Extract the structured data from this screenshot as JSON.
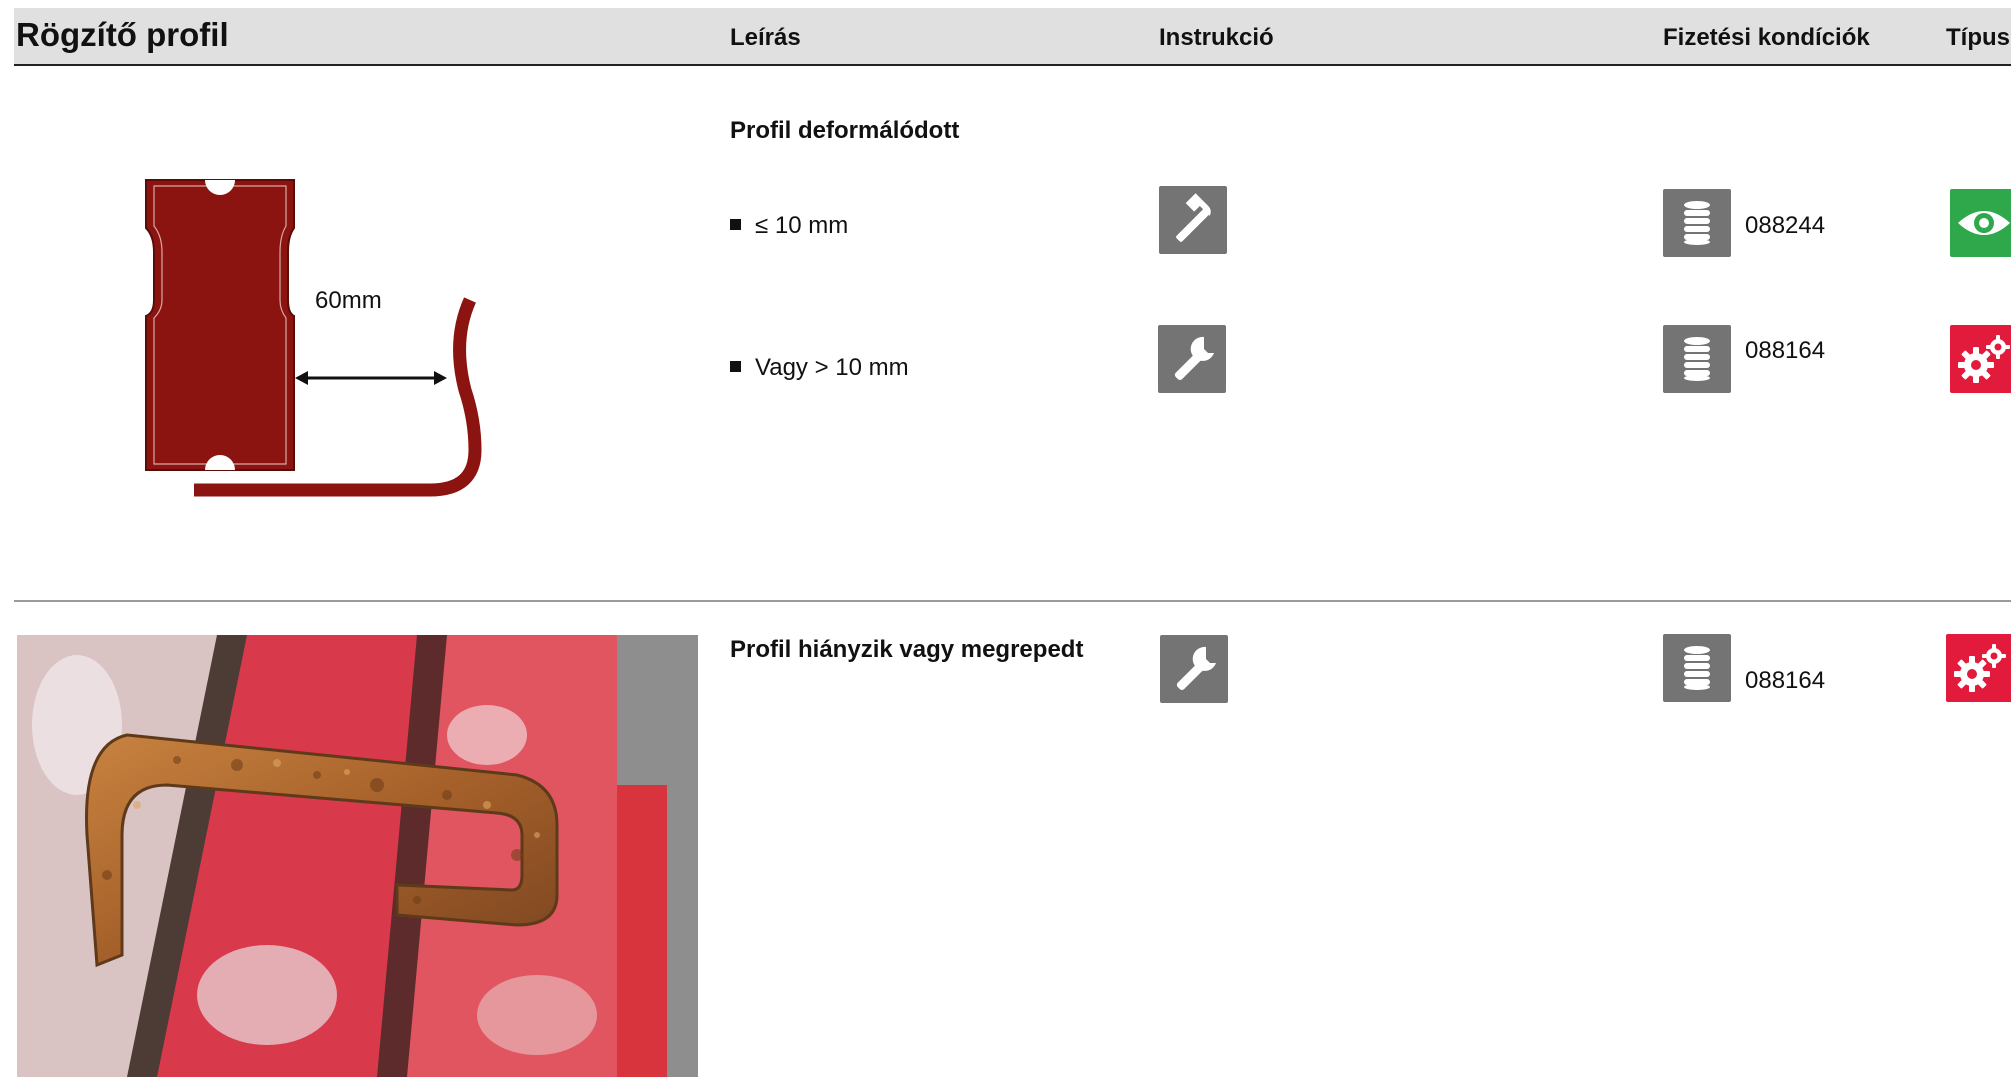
{
  "header": {
    "title": "Rögzítő profil",
    "columns": [
      "Leírás",
      "Instrukció",
      "Fizetési kondíciók",
      "Típus"
    ]
  },
  "rows": [
    {
      "heading": "Profil deformálódott",
      "diagram_label": "60mm",
      "items": [
        {
          "text": "≤ 10 mm",
          "instruction_icon": "hammer-icon",
          "payment_icon": "coin-stack-icon",
          "code": "088244",
          "type_icon": "eye-icon",
          "type_color": "#2ea84a"
        },
        {
          "text": "Vagy > 10 mm",
          "instruction_icon": "wrench-icon",
          "payment_icon": "coin-stack-icon",
          "code": "088164",
          "type_icon": "gears-icon",
          "type_color": "#e21b3c"
        }
      ]
    },
    {
      "heading": "Profil hiányzik vagy megrepedt",
      "instruction_icon": "wrench-icon",
      "payment_icon": "coin-stack-icon",
      "code": "088164",
      "type_icon": "gears-icon",
      "type_color": "#e21b3c"
    }
  ]
}
